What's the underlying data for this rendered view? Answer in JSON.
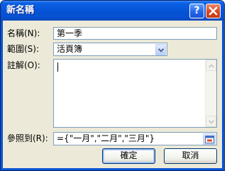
{
  "window": {
    "title": "新名稱",
    "help_label": "?"
  },
  "form": {
    "name_label": "名稱(N):",
    "name_value": "第一季",
    "scope_label": "範圍(S):",
    "scope_value": "活頁簿",
    "comment_label": "註解(O):",
    "comment_value": "",
    "refers_label": "參照到(R):",
    "refers_value": "={\"一月\",\"二月\",\"三月\"}"
  },
  "buttons": {
    "ok_label": "確定",
    "cancel_label": "取消"
  },
  "icons": {
    "help": "help-icon",
    "close": "close-icon",
    "dropdown": "chevron-down-icon",
    "scroll_up": "arrow-up-icon",
    "scroll_down": "arrow-down-icon",
    "range_picker": "range-select-icon"
  },
  "colors": {
    "title_bar": "#0653d6",
    "dialog_face": "#ece9d8",
    "close_button": "#d6461f",
    "field_border": "#7f9db9"
  }
}
